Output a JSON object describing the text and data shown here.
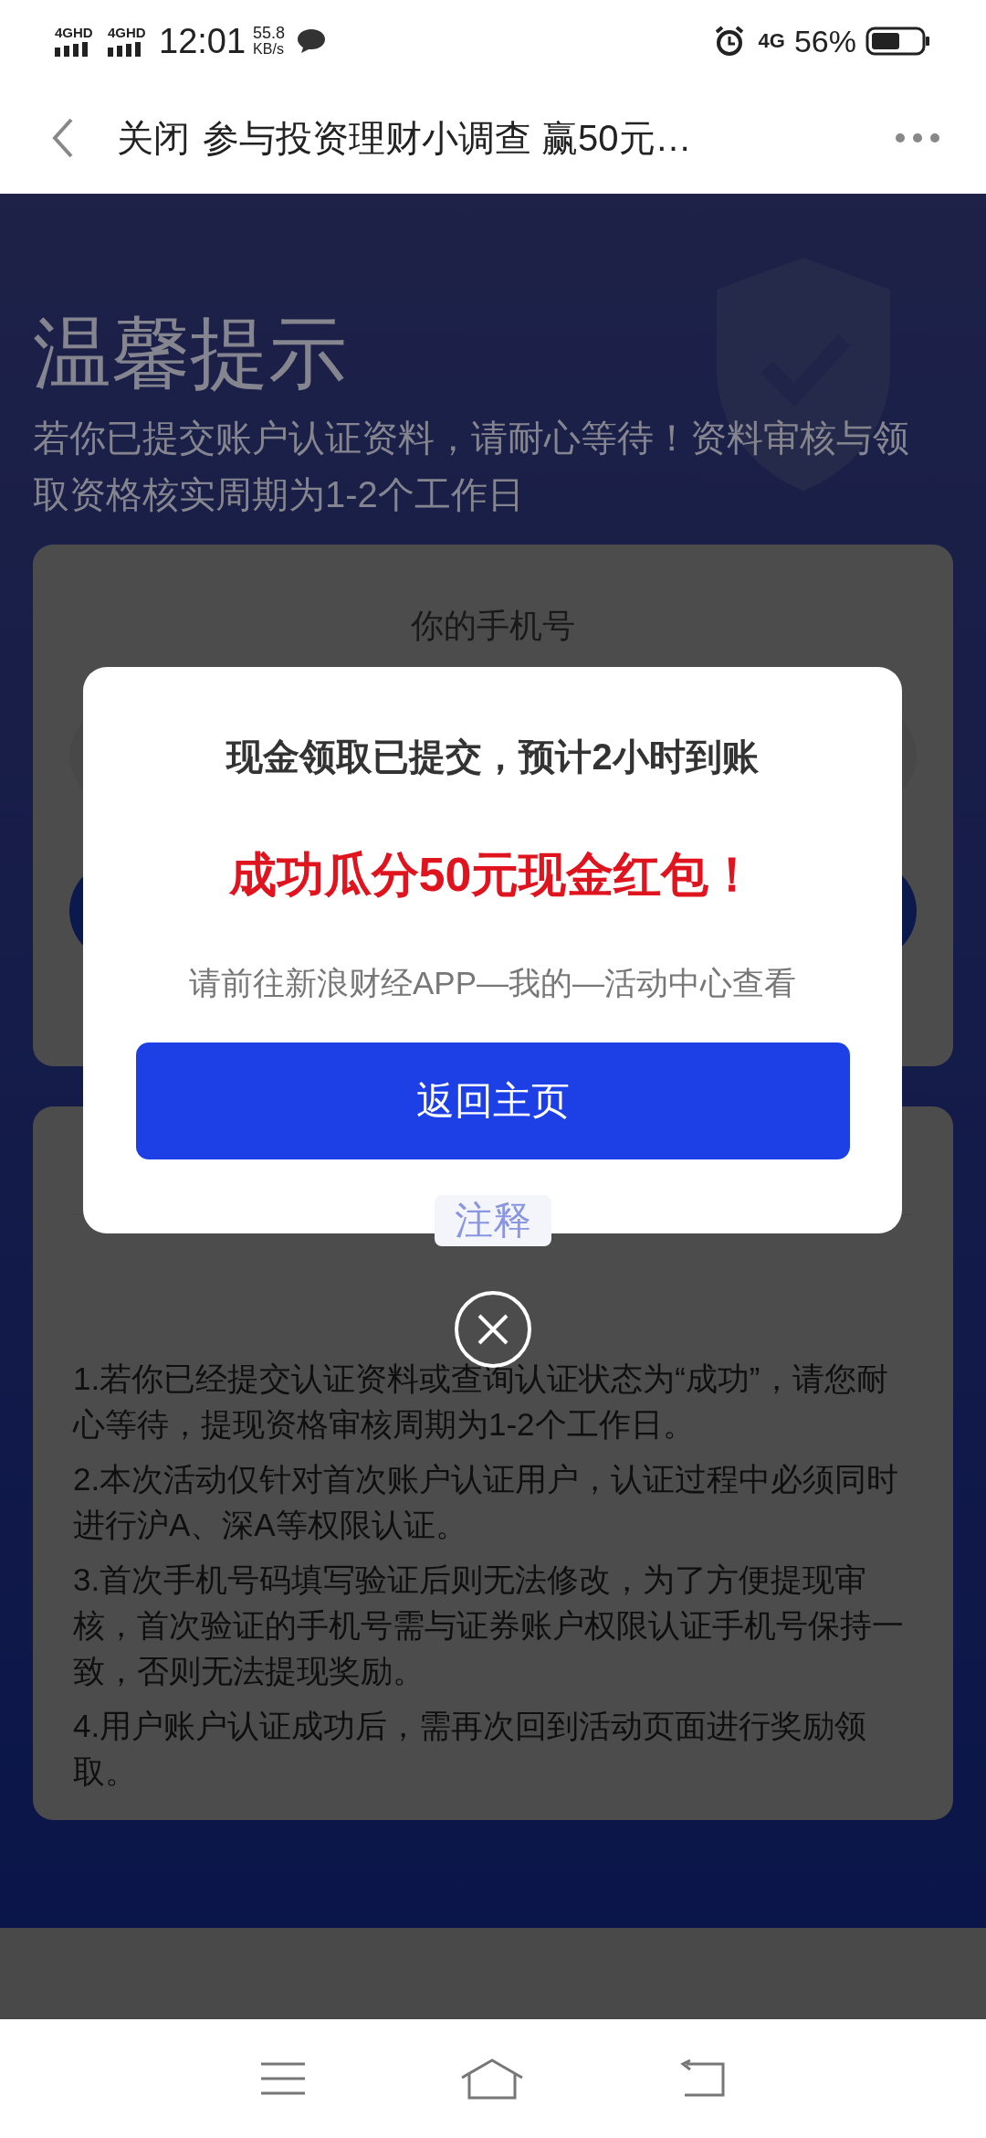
{
  "status_bar": {
    "signals": [
      "4GHD",
      "4GHD"
    ],
    "time": "12:01",
    "speed_value": "55.8",
    "speed_unit": "KB/s",
    "network": "4G",
    "battery": "56%"
  },
  "nav": {
    "close_label": "关闭",
    "title": "参与投资理财小调查 赢50元…"
  },
  "page": {
    "heading": "温馨提示",
    "subtitle": "若你已提交账户认证资料，请耐心等待！资料审核与领取资格核实周期为1-2个工作日",
    "phone_card": {
      "label": "你的手机号"
    },
    "notes_card": {
      "title": "注释",
      "items": [
        "1.若你已经提交认证资料或查询认证状态为“成功”，请您耐心等待，提现资格审核周期为1-2个工作日。",
        "2.本次活动仅针对首次账户认证用户，认证过程中必须同时进行沪A、深A等权限认证。",
        "3.首次手机号码填写验证后则无法修改，为了方便提现审核，首次验证的手机号需与证券账户权限认证手机号保持一致，否则无法提现奖励。",
        "4.用户账户认证成功后，需再次回到活动页面进行奖励领取。"
      ]
    }
  },
  "modal": {
    "title": "现金领取已提交，预计2小时到账",
    "highlight": "成功瓜分50元现金红包！",
    "hint": "请前往新浪财经APP—我的—活动中心查看",
    "button": "返回主页"
  }
}
